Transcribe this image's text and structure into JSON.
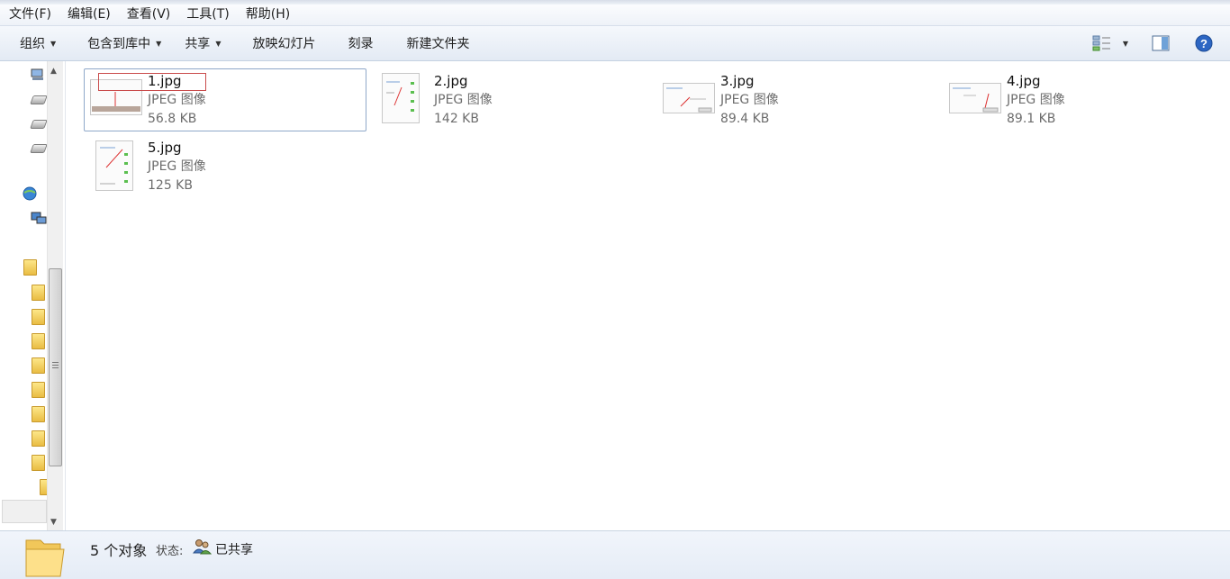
{
  "menubar": {
    "items": [
      "文件(F)",
      "编辑(E)",
      "查看(V)",
      "工具(T)",
      "帮助(H)"
    ]
  },
  "toolbar": {
    "organize": "组织",
    "include_in_library": "包含到库中",
    "share": "共享",
    "slideshow": "放映幻灯片",
    "burn": "刻录",
    "new_folder": "新建文件夹",
    "icons": [
      "view-options-icon",
      "preview-pane-icon",
      "help-icon"
    ]
  },
  "files": [
    {
      "name": "1.jpg",
      "type": "JPEG 图像",
      "size": "56.8 KB"
    },
    {
      "name": "2.jpg",
      "type": "JPEG 图像",
      "size": "142 KB"
    },
    {
      "name": "3.jpg",
      "type": "JPEG 图像",
      "size": "89.4 KB"
    },
    {
      "name": "4.jpg",
      "type": "JPEG 图像",
      "size": "89.1 KB"
    },
    {
      "name": "5.jpg",
      "type": "JPEG 图像",
      "size": "125 KB"
    }
  ],
  "status": {
    "count": "5 个对象",
    "state_label": "状态:",
    "state_value": "已共享"
  },
  "colors": {
    "selection_border": "#8fa8c9",
    "rename_outline": "#c94b4b",
    "toolbar_bg": "#e3eaf4"
  }
}
